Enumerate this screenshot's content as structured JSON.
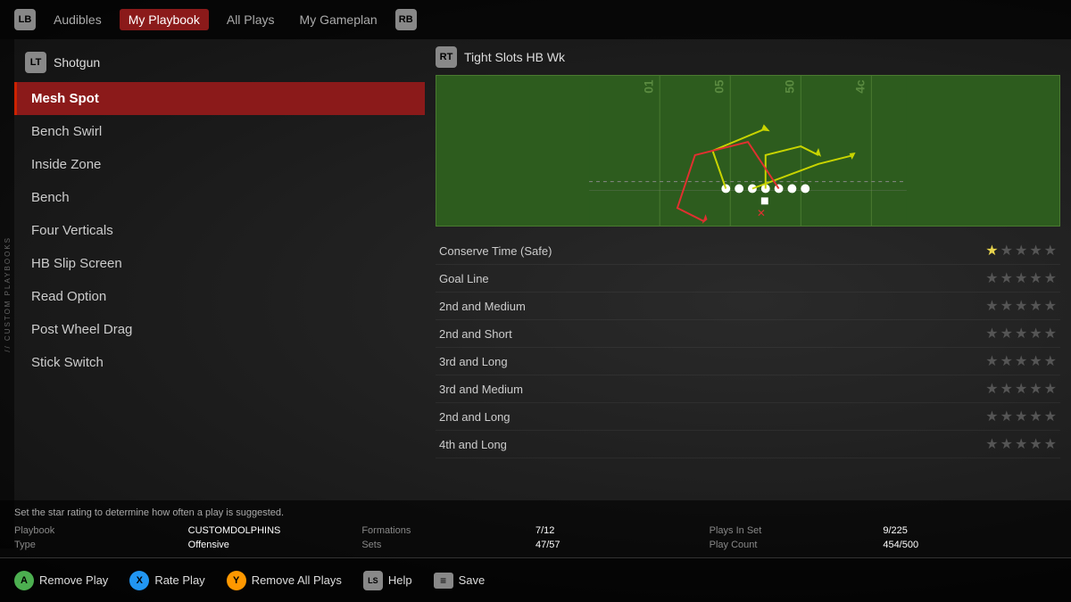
{
  "nav": {
    "lb": "LB",
    "rb": "RB",
    "lt": "LT",
    "rt": "RT",
    "tabs": [
      {
        "label": "Audibles",
        "active": false
      },
      {
        "label": "My Playbook",
        "active": true
      },
      {
        "label": "All Plays",
        "active": false
      },
      {
        "label": "My Gameplan",
        "active": false
      }
    ]
  },
  "sidebar": {
    "label": "// CUSTOM PLAYBOOKS"
  },
  "formation": {
    "left_label": "Shotgun",
    "right_label": "Tight Slots HB Wk"
  },
  "plays": [
    {
      "name": "Mesh Spot",
      "selected": true
    },
    {
      "name": "Bench Swirl",
      "selected": false
    },
    {
      "name": "Inside Zone",
      "selected": false
    },
    {
      "name": "Bench",
      "selected": false
    },
    {
      "name": "Four Verticals",
      "selected": false
    },
    {
      "name": "HB Slip Screen",
      "selected": false
    },
    {
      "name": "Read Option",
      "selected": false
    },
    {
      "name": "Post Wheel Drag",
      "selected": false
    },
    {
      "name": "Stick Switch",
      "selected": false
    }
  ],
  "ratings": [
    {
      "situation": "Conserve Time (Safe)",
      "stars": 1
    },
    {
      "situation": "Goal Line",
      "stars": 0
    },
    {
      "situation": "2nd and Medium",
      "stars": 0
    },
    {
      "situation": "2nd and Short",
      "stars": 0
    },
    {
      "situation": "3rd and Long",
      "stars": 0
    },
    {
      "situation": "3rd and Medium",
      "stars": 0
    },
    {
      "situation": "2nd and Long",
      "stars": 0
    },
    {
      "situation": "4th and Long",
      "stars": 0
    }
  ],
  "hint": "Set the star rating to determine how often a play is suggested.",
  "stats": {
    "playbook_label": "Playbook",
    "playbook_value": "CUSTOMDOLPHINS",
    "formations_label": "Formations",
    "formations_value": "7/12",
    "plays_in_set_label": "Plays In Set",
    "plays_in_set_value": "9/225",
    "type_label": "Type",
    "type_value": "Offensive",
    "sets_label": "Sets",
    "sets_value": "47/57",
    "play_count_label": "Play Count",
    "play_count_value": "454/500"
  },
  "actions": [
    {
      "btn": "A",
      "btn_class": "btn-a",
      "label": "Remove Play"
    },
    {
      "btn": "X",
      "btn_class": "btn-x",
      "label": "Rate Play"
    },
    {
      "btn": "Y",
      "btn_class": "btn-y",
      "label": "Remove All Plays"
    },
    {
      "btn": "LS",
      "btn_class": "btn-ls",
      "label": "Help"
    },
    {
      "btn": "≡",
      "btn_class": "btn-menu",
      "label": "Save"
    }
  ]
}
